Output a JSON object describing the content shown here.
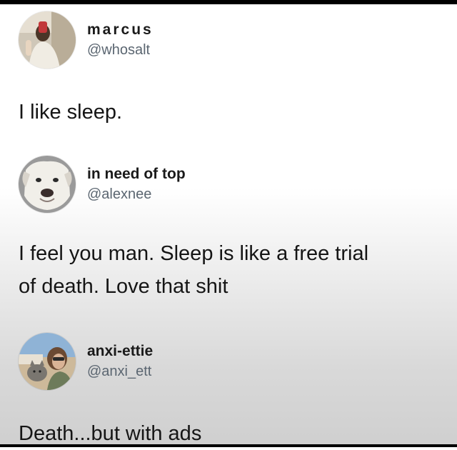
{
  "posts": [
    {
      "display_name": "marcus",
      "handle": "@whosalt",
      "text": "I like sleep.",
      "avatar_icon": "person-mirror-selfie-avatar"
    },
    {
      "display_name": "in need of top",
      "handle": "@alexnee",
      "text_lines": [
        "I feel you man. Sleep is like a free trial",
        "of death. Love that shit"
      ],
      "avatar_icon": "white-dog-avatar"
    },
    {
      "display_name": "anxi-ettie",
      "handle": "@anxi_ett",
      "text": "Death...but with ads",
      "avatar_icon": "person-with-cat-avatar"
    }
  ]
}
